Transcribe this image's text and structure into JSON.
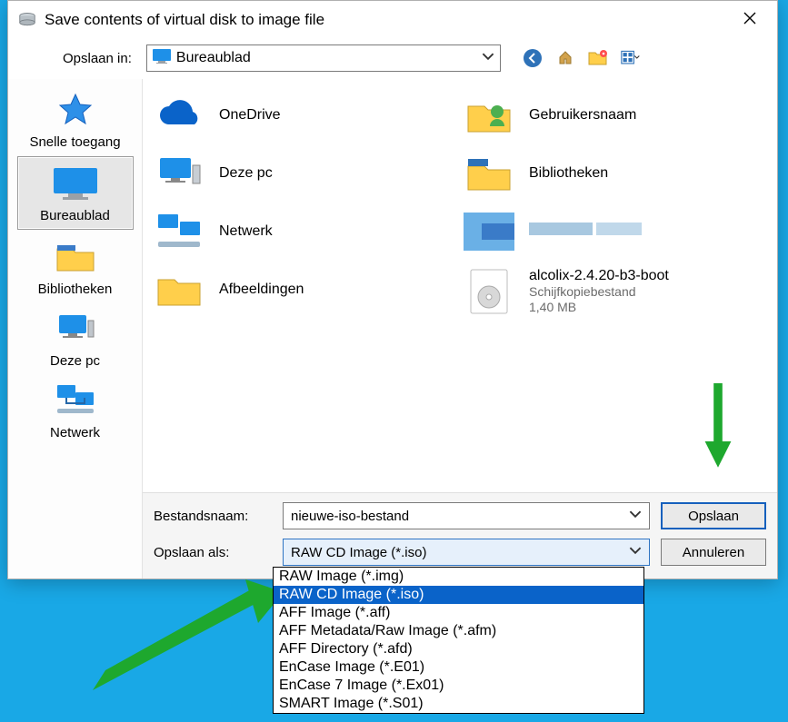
{
  "title": "Save contents of virtual disk to image file",
  "toolbar": {
    "label": "Opslaan in:",
    "location": "Bureaublad"
  },
  "sidebar": {
    "items": [
      {
        "label": "Snelle toegang"
      },
      {
        "label": "Bureaublad"
      },
      {
        "label": "Bibliotheken"
      },
      {
        "label": "Deze pc"
      },
      {
        "label": "Netwerk"
      }
    ],
    "selected_index": 1
  },
  "files": {
    "left": [
      {
        "label": "OneDrive"
      },
      {
        "label": "Deze pc"
      },
      {
        "label": "Netwerk"
      },
      {
        "label": "Afbeeldingen"
      }
    ],
    "right": [
      {
        "label": "Gebruikersnaam"
      },
      {
        "label": "Bibliotheken"
      },
      {
        "label": ""
      },
      {
        "label": "alcolix-2.4.20-b3-boot",
        "sub1": "Schijfkopiebestand",
        "sub2": "1,40 MB"
      }
    ]
  },
  "bottom": {
    "name_label": "Bestandsnaam:",
    "name_value": "nieuwe-iso-bestand",
    "type_label": "Opslaan als:",
    "type_value": "RAW CD Image (*.iso)",
    "save": "Opslaan",
    "cancel": "Annuleren"
  },
  "dropdown": {
    "options": [
      "RAW Image (*.img)",
      "RAW CD Image (*.iso)",
      "AFF Image (*.aff)",
      "AFF Metadata/Raw Image (*.afm)",
      "AFF Directory (*.afd)",
      "EnCase Image (*.E01)",
      "EnCase 7 Image (*.Ex01)",
      "SMART Image (*.S01)"
    ],
    "selected_index": 1
  }
}
